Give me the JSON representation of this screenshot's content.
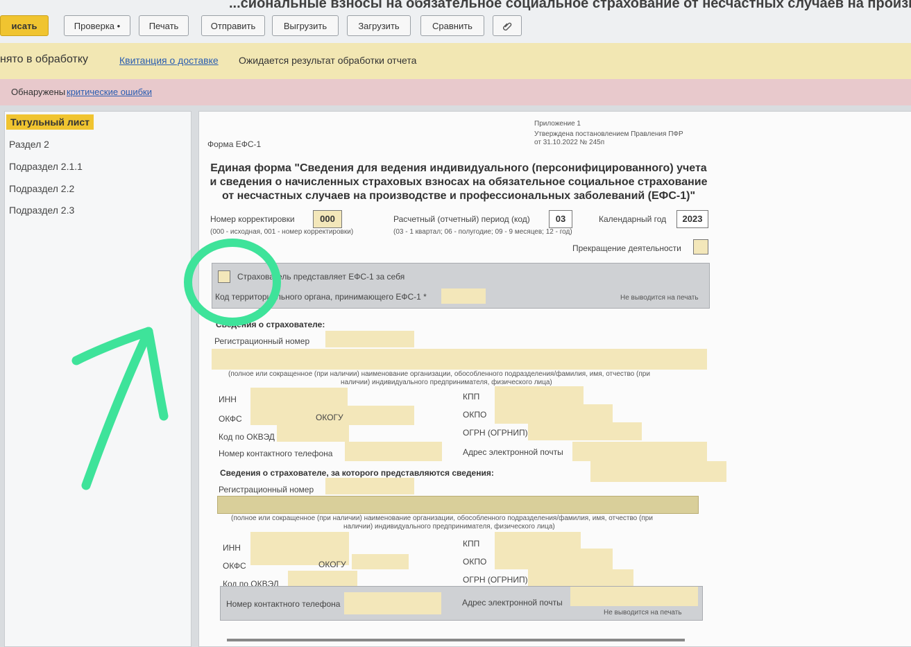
{
  "toolbar": {
    "title": "...сиональные взносы на обязательное социальное страхование от несчастных случаев на производ",
    "buttons": [
      "исать",
      "Проверка •",
      "Печать",
      "Отправить",
      "Выгрузить",
      "Загрузить",
      "Сравнить"
    ]
  },
  "status": {
    "state": "нято в обработку",
    "link": "Квитанция о доставке",
    "message": "Ожидается результат обработки отчета"
  },
  "errors": {
    "prefix": "Обнаружены",
    "link": "критические ошибки"
  },
  "sidebar": {
    "items": [
      "Титульный лист",
      "Раздел 2",
      "Подраздел 2.1.1",
      "Подраздел 2.2",
      "Подраздел 2.3"
    ]
  },
  "form": {
    "appendix": "Приложение 1",
    "approved": "Утверждена постановлением Правления ПФР",
    "approved_date": "от 31.10.2022 № 245п",
    "form_name": "Форма ЕФС-1",
    "title": "Единая форма \"Сведения для ведения индивидуального (персонифицированного) учета и сведения о начисленных страховых взносах на обязательное социальное страхование от несчастных случаев на производстве и профессиональных заболеваний (ЕФС-1)\"",
    "correction_label": "Номер корректировки",
    "correction_value": "000",
    "correction_hint": "(000 - исходная, 001 - номер корректировки)",
    "period_label": "Расчетный (отчетный) период (код)",
    "period_value": "03",
    "period_hint": "(03 - 1 квартал; 06 - полугодие; 09 - 9 месяцев; 12 - год)",
    "year_label": "Календарный год",
    "year_value": "2023",
    "termination": "Прекращение деятельности",
    "self_label": "Страхователь представляет ЕФС-1 за себя",
    "terr_code_label": "Код территориального органа, принимающего ЕФС-1 *",
    "no_print": "Не выводится на печать",
    "insurer_heading": "Сведения о страхователе:",
    "reg_number": "Регистрационный номер",
    "name_hint_1": "(полное или сокращенное (при наличии) наименование организации, обособленного подразделения/фамилия, имя, отчество (при",
    "name_hint_2": "наличии) индивидуального предпринимателя, физического лица)",
    "inn": "ИНН",
    "kpp": "КПП",
    "okfs": "ОКФС",
    "okogu": "ОКОГУ",
    "okpo": "ОКПО",
    "okved": "Код по ОКВЭД",
    "ogrn": "ОГРН (ОГРНИП)",
    "phone": "Номер контактного телефона",
    "email": "Адрес электронной почты",
    "second_heading": "Сведения о страхователе, за которого представляются сведения:"
  },
  "colors": {
    "accent": "#f0c430",
    "status_bg": "#f2e7b3",
    "error_bg": "#e8c9cc",
    "field_fill": "#f3e7ba",
    "annotation": "#3ee39a"
  },
  "icons": {
    "attach": "paperclip-icon"
  }
}
